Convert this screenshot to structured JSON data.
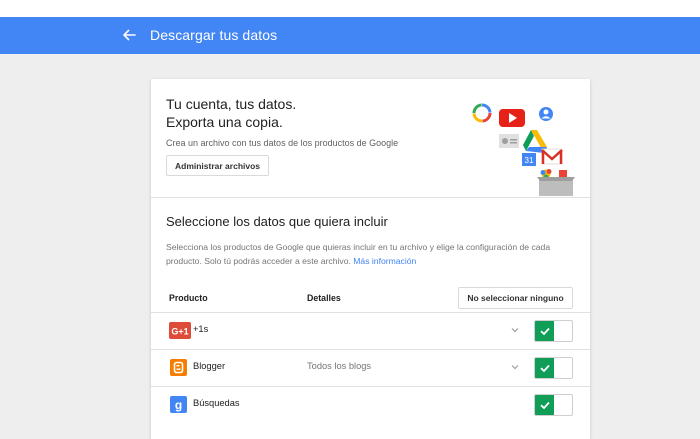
{
  "appbar": {
    "title": "Descargar tus datos",
    "back_icon": "arrow-left-icon",
    "color": "#4285f4"
  },
  "hero": {
    "title_line1": "Tu cuenta, tus datos.",
    "title_line2": "Exporta una copia.",
    "description": "Crea un archivo con tus datos de los productos de Google",
    "manage_button": "Administrar archivos",
    "collage_icons": [
      "google-photos-icon",
      "youtube-icon",
      "contacts-icon",
      "google-drive-icon",
      "contacts-card-icon",
      "calendar-icon",
      "gmail-icon",
      "photos-small-icon",
      "archive-box-icon"
    ]
  },
  "section": {
    "title": "Seleccione los datos que quiera incluir",
    "description": "Selecciona los productos de Google que quieras incluir en tu archivo y elige la configuración de cada producto. Solo tú podrás acceder a este archivo.",
    "link": "Más información"
  },
  "table": {
    "col_product": "Producto",
    "col_details": "Detalles",
    "deselect_button": "No seleccionar ninguno",
    "rows": [
      {
        "name": "+1s",
        "details": "",
        "icon": "google-plus-one-icon",
        "expandable": true,
        "selected": true
      },
      {
        "name": "Blogger",
        "details": "Todos los blogs",
        "icon": "blogger-icon",
        "expandable": true,
        "selected": true
      },
      {
        "name": "Búsquedas",
        "details": "",
        "icon": "google-search-icon",
        "expandable": false,
        "selected": true
      }
    ]
  },
  "colors": {
    "toggle_on": "#0f9d58",
    "link": "#4285f4"
  }
}
